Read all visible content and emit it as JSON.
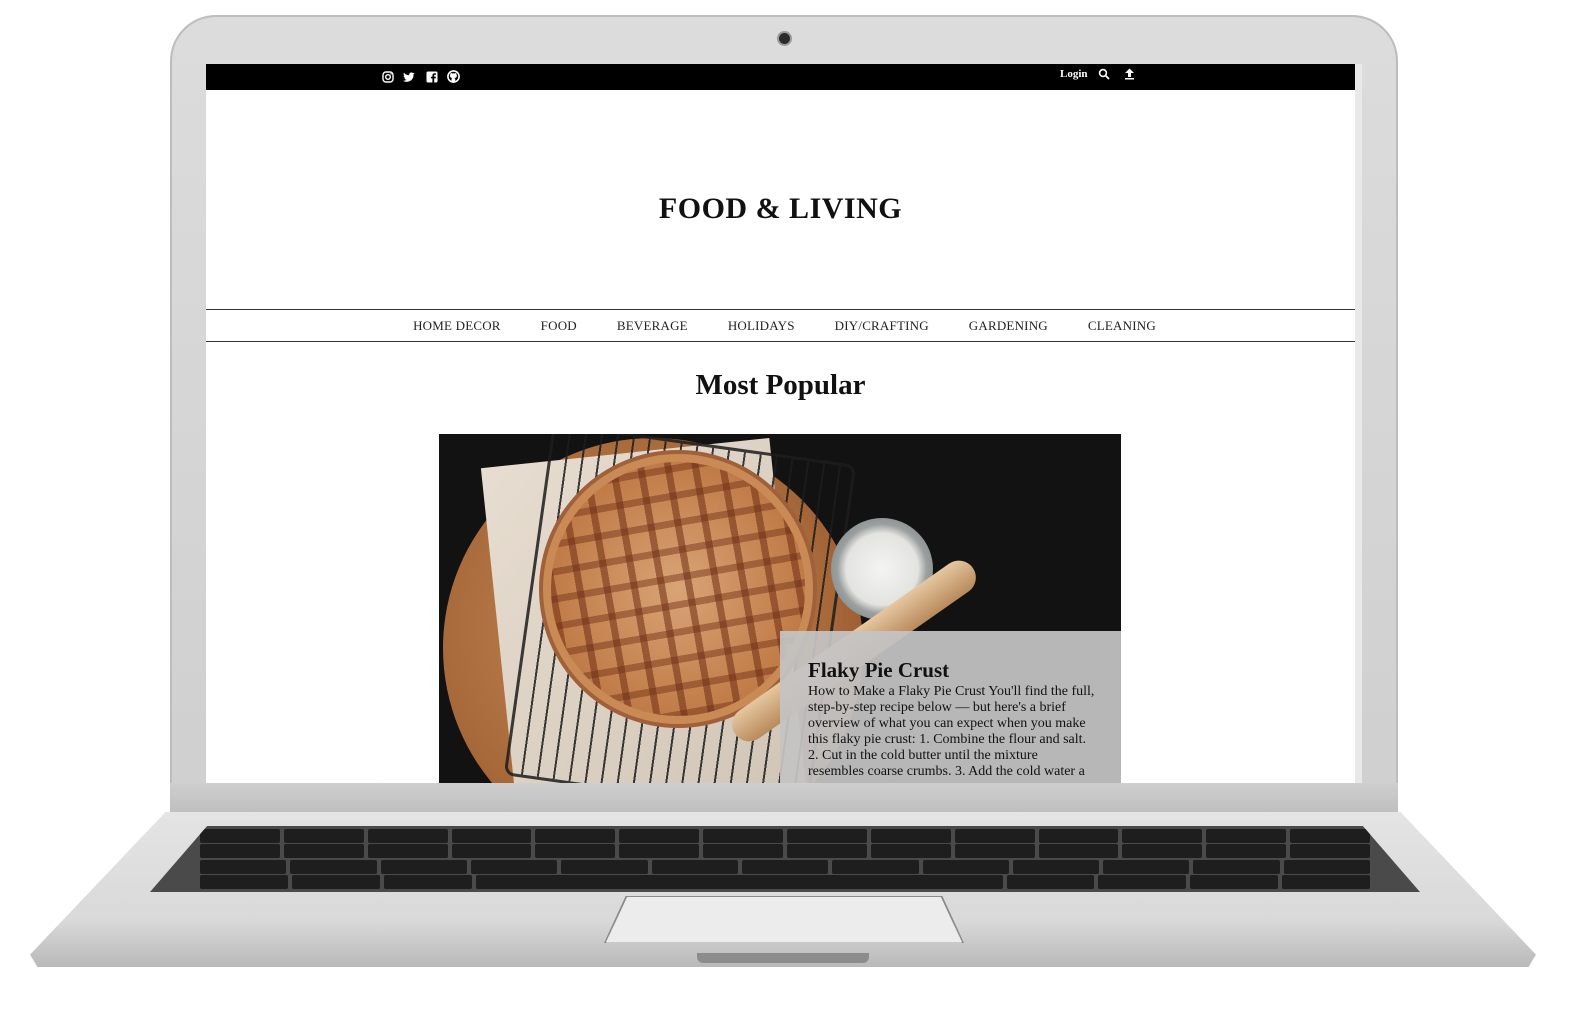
{
  "topbar": {
    "social_icons": [
      "instagram-icon",
      "twitter-icon",
      "facebook-icon",
      "github-icon"
    ],
    "login_label": "Login",
    "action_icons": [
      "search-icon",
      "upload-icon"
    ]
  },
  "site": {
    "title": "FOOD & LIVING"
  },
  "nav": {
    "items": [
      "HOME DECOR",
      "FOOD",
      "BEVERAGE",
      "HOLIDAYS",
      "DIY/CRAFTING",
      "GARDENING",
      "CLEANING"
    ]
  },
  "main": {
    "section_title": "Most Popular",
    "featured": {
      "title": "Flaky Pie Crust",
      "excerpt": "How to Make a Flaky Pie Crust You'll find the full, step-by-step recipe below — but here's a brief overview of what you can expect when you make this flaky pie crust: 1. Combine the flour and salt. 2. Cut in the cold butter until the mixture resembles coarse crumbs. 3. Add the cold water a"
    }
  },
  "colors": {
    "topbar_bg": "#000000",
    "overlay_bg": "#c4c4c4",
    "text": "#111111"
  }
}
